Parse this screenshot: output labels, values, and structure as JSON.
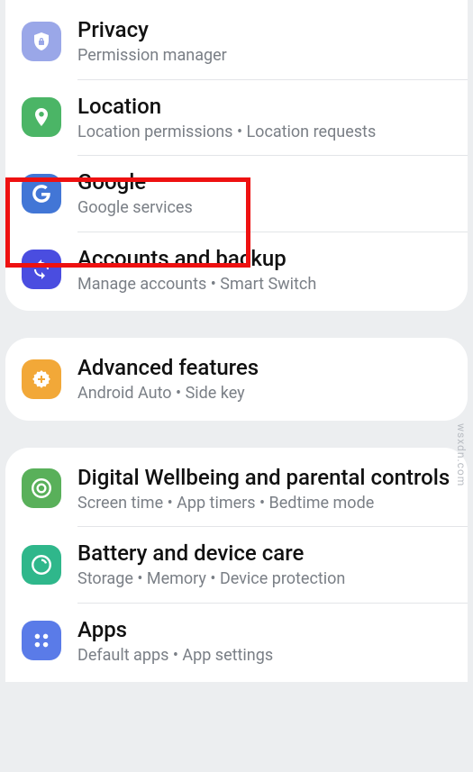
{
  "card1": {
    "privacy": {
      "title": "Privacy",
      "sub": "Permission manager"
    },
    "location": {
      "title": "Location",
      "sub": "Location permissions  •  Location requests"
    },
    "google": {
      "title": "Google",
      "sub": "Google services"
    },
    "accounts": {
      "title": "Accounts and backup",
      "sub": "Manage accounts  •  Smart Switch"
    }
  },
  "card2": {
    "advanced": {
      "title": "Advanced features",
      "sub": "Android Auto  •  Side key"
    }
  },
  "card3": {
    "wellbeing": {
      "title": "Digital Wellbeing and parental controls",
      "sub": "Screen time  •  App timers  •  Bedtime mode"
    },
    "battery": {
      "title": "Battery and device care",
      "sub": "Storage  •  Memory  •  Device protection"
    },
    "apps": {
      "title": "Apps",
      "sub": "Default apps  •  App settings"
    }
  },
  "watermark": "wsxdn.com"
}
